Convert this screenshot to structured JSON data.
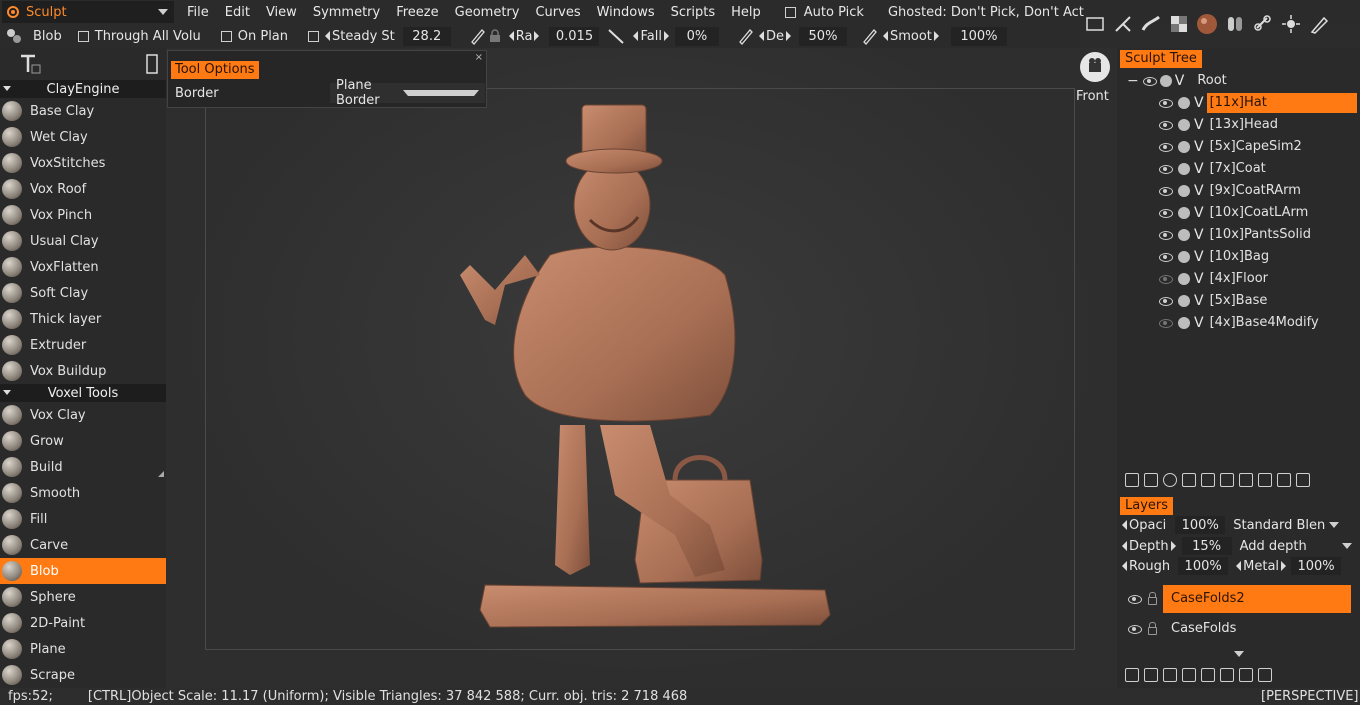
{
  "menubar": {
    "room": "Sculpt",
    "items": [
      "File",
      "Edit",
      "View",
      "Symmetry",
      "Freeze",
      "Geometry",
      "Curves",
      "Windows",
      "Scripts",
      "Help"
    ],
    "auto_pick": "Auto Pick",
    "ghosted": "Ghosted: Don't Pick, Don't Act"
  },
  "toolbar": {
    "tool_name": "Blob",
    "through_all": "Through All Volu",
    "on_plane": "On Plan",
    "steady": "Steady St",
    "steady_val": "28.2",
    "radius": "Ra",
    "radius_val": "0.015",
    "falloff": "Fall",
    "falloff_val": "0%",
    "depth": "De",
    "depth_val": "50%",
    "smooth": "Smoot",
    "smooth_val": "100%"
  },
  "left_panel": {
    "sections": [
      {
        "title": "ClayEngine",
        "tools": [
          "Base Clay",
          "Wet Clay",
          "VoxStitches",
          "Vox Roof",
          "Vox Pinch",
          "Usual Clay",
          "VoxFlatten",
          "Soft Clay",
          "Thick layer",
          "Extruder",
          "Vox Buildup"
        ]
      },
      {
        "title": "Voxel Tools",
        "tools": [
          "Vox Clay",
          "Grow",
          "Build",
          "Smooth",
          "Fill",
          "Carve",
          "Blob",
          "Sphere",
          "2D-Paint",
          "Plane",
          "Scrape"
        ]
      }
    ],
    "active_tool": "Blob"
  },
  "tool_options": {
    "title": "Tool Options",
    "close": "×",
    "field_label": "Border",
    "field_value": "Plane Border"
  },
  "viewport": {
    "view_label": "Front",
    "projection": "[PERSPECTIVE]"
  },
  "sculpt_tree": {
    "title": "Sculpt Tree",
    "root": "Root",
    "items": [
      {
        "label": "[11x]Hat",
        "visible": true,
        "selected": true
      },
      {
        "label": "[13x]Head",
        "visible": true
      },
      {
        "label": "[5x]CapeSim2",
        "visible": true
      },
      {
        "label": "[7x]Coat",
        "visible": true
      },
      {
        "label": "[9x]CoatRArm",
        "visible": true
      },
      {
        "label": "[10x]CoatLArm",
        "visible": true
      },
      {
        "label": "[10x]PantsSolid",
        "visible": true
      },
      {
        "label": "[10x]Bag",
        "visible": true
      },
      {
        "label": "[4x]Floor",
        "visible": false
      },
      {
        "label": "[5x]Base",
        "visible": true
      },
      {
        "label": "[4x]Base4Modify",
        "visible": false
      }
    ]
  },
  "layers": {
    "title": "Layers",
    "opacity_label": "Opaci",
    "opacity_val": "100%",
    "blend_mode": "Standard Blen",
    "depth_label": "Depth",
    "depth_val": "15%",
    "depth_mode": "Add depth",
    "rough_label": "Rough",
    "rough_val": "100%",
    "metal_label": "Metal",
    "metal_val": "100%",
    "items": [
      {
        "label": "CaseFolds2",
        "selected": true
      },
      {
        "label": "CaseFolds"
      }
    ]
  },
  "status": {
    "fps": "fps:52;",
    "info": "[CTRL]Object Scale: 11.17 (Uniform); Visible Triangles: 37 842 588; Curr. obj. tris: 2 718 468"
  },
  "colors": {
    "accent": "#ff7a12",
    "panel": "#2a2a2a",
    "clay": "#b47a5e"
  }
}
